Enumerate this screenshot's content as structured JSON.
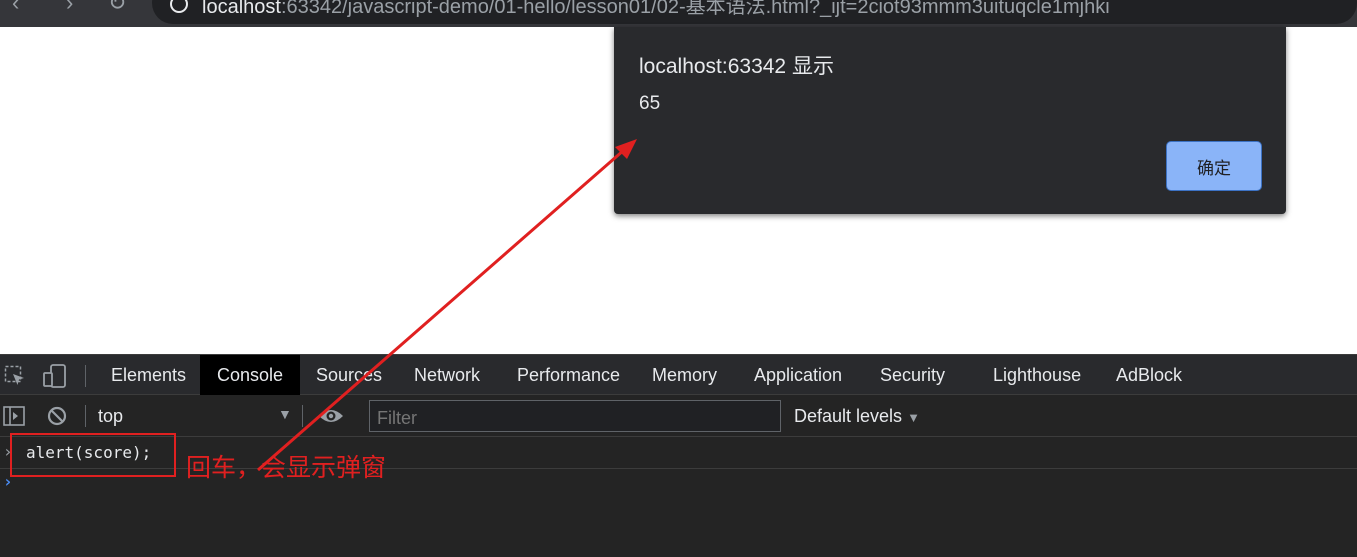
{
  "browser": {
    "url_host": "localhost",
    "url_rest": ":63342/javascript-demo/01-hello/lesson01/02-基本语法.html?_ijt=2ciot93mmm3uituqcle1mjhki"
  },
  "dialog": {
    "title": "localhost:63342 显示",
    "message": "65",
    "ok_label": "确定"
  },
  "devtools": {
    "tabs": [
      "Elements",
      "Console",
      "Sources",
      "Network",
      "Performance",
      "Memory",
      "Application",
      "Security",
      "Lighthouse",
      "AdBlock"
    ],
    "active_tab": "Console",
    "context": "top",
    "filter_placeholder": "Filter",
    "levels_label": "Default levels"
  },
  "console": {
    "command": "alert(score);"
  },
  "annotation": {
    "text": "回车，会显示弹窗",
    "color": "#e02020"
  },
  "colors": {
    "accent": "#8ab4f8",
    "devtools_bg": "#242424",
    "dialog_bg": "#292a2d"
  }
}
